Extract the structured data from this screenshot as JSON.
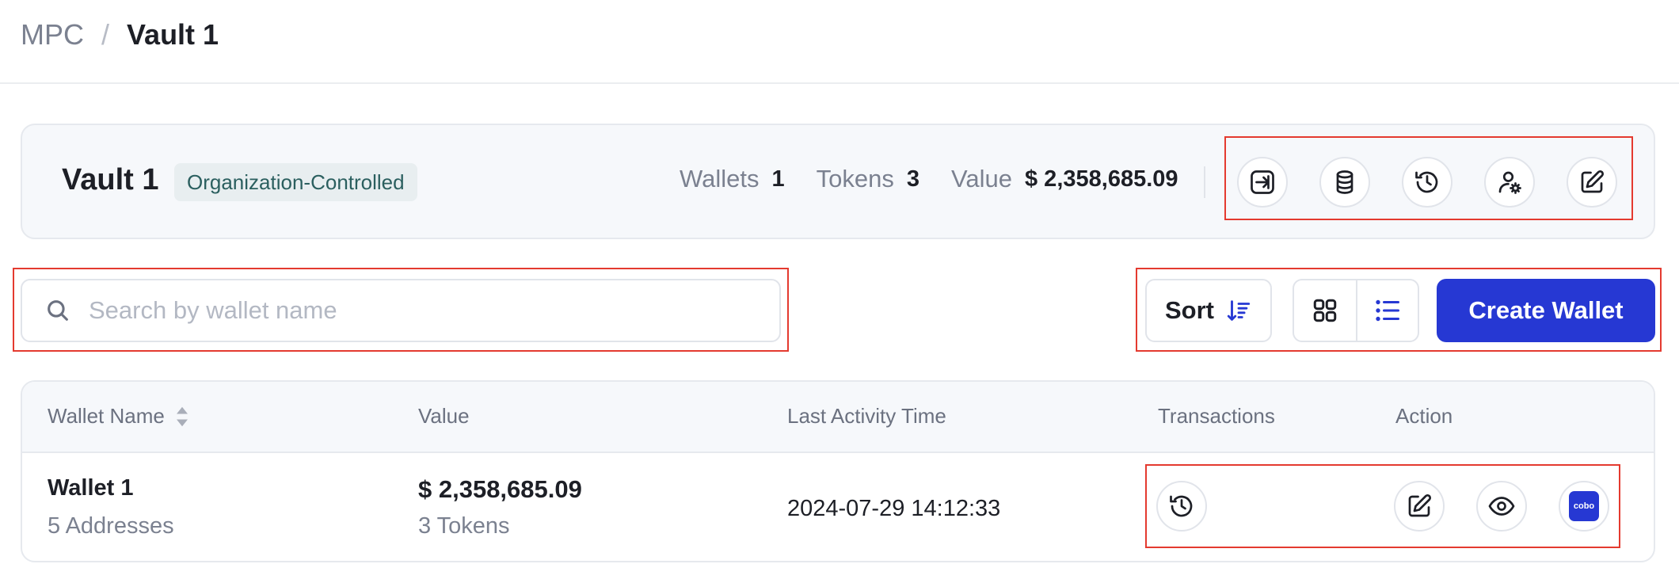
{
  "breadcrumb": {
    "root": "MPC",
    "separator": "/",
    "current": "Vault 1"
  },
  "vault": {
    "name": "Vault 1",
    "badge": "Organization-Controlled",
    "stats": [
      {
        "label": "Wallets",
        "value": "1"
      },
      {
        "label": "Tokens",
        "value": "3"
      },
      {
        "label": "Value",
        "value": "$ 2,358,685.09"
      }
    ],
    "actions": [
      "login-icon",
      "database-icon",
      "history-icon",
      "user-gear-icon",
      "edit-icon"
    ]
  },
  "search": {
    "placeholder": "Search by wallet name",
    "value": ""
  },
  "toolbar": {
    "sort_label": "Sort",
    "create_label": "Create Wallet",
    "view_options": [
      "grid-view-icon",
      "list-view-icon"
    ],
    "active_view": "list"
  },
  "table": {
    "columns": [
      "Wallet Name",
      "Value",
      "Last Activity Time",
      "Transactions",
      "Action"
    ],
    "rows": [
      {
        "wallet_name": "Wallet 1",
        "addresses": "5 Addresses",
        "value": "$ 2,358,685.09",
        "tokens": "3 Tokens",
        "last_activity": "2024-07-29 14:12:33",
        "cobo_label": "cobo"
      }
    ]
  },
  "colors": {
    "accent": "#2638d3",
    "highlight": "#e43a2f",
    "badge_bg": "#e8eef0",
    "badge_text": "#2b5f5f"
  }
}
